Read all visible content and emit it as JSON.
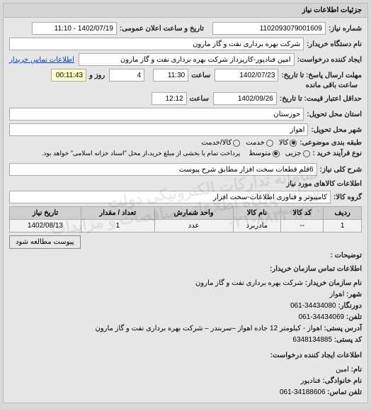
{
  "panel_title": "جزئیات اطلاعات نیاز",
  "labels": {
    "request_no": "شماره نیاز:",
    "announce_date": "تاریخ و ساعت اعلان عمومی:",
    "buyer_org": "نام دستگاه خریدار:",
    "creator": "ایجاد کننده درخواست:",
    "contact_link": "اطلاعات تماس خریدار",
    "deadline": "مهلت ارسال پاسخ: تا تاریخ:",
    "time": "ساعت",
    "day": "روز و",
    "remaining": "ساعت باقی مانده",
    "price_validity": "حداقل اعتبار قیمت: تا تاریخ:",
    "province": "استان محل تحویل:",
    "city": "شهر محل تحویل:",
    "category": "طبقه بندی موضوعی:",
    "process_type": "نوع فرآیند خرید :",
    "opt_goods": "کالا",
    "opt_service": "خدمت",
    "opt_goods_service": "کالا/خدمت",
    "opt_small": "جزیی",
    "opt_medium": "متوسط",
    "process_note": "پرداخت تمام یا بخشی از مبلغ خرید،از محل \"اسناد خزانه اسلامی\" خواهد بود.",
    "general_desc": "شرح کلی نیاز:",
    "goods_info_title": "اطلاعات کالاهای مورد نیاز",
    "goods_group": "گروه کالا:",
    "attach_btn": "پیوست مطالعه شود",
    "explanations": "توضیحات :",
    "contact_title": "اطلاعات تماس سازمان خریدار:",
    "org_name": "نام سازمان خریدار:",
    "city_info": "شهر:",
    "fax": "دورنگار:",
    "phone": "تلفن:",
    "address": "آدرس پستی:",
    "postal_code": "کد پستی:",
    "creator_title": "اطلاعات ایجاد کننده درخواست:",
    "name": "نام:",
    "surname": "نام خانوادگی:",
    "contact_phone": "تلفن تماس:"
  },
  "values": {
    "request_no": "1102093079001609",
    "announce_date": "1402/07/19 - 11:10",
    "buyer_org": "شرکت بهره برداری نفت و گاز مارون",
    "creator": "امین فنادپور-کارپرداز شرکت بهره برداری نفت و گاز مارون",
    "deadline_date": "1402/07/23",
    "deadline_time": "11:30",
    "remaining_days": "4",
    "remaining_time": "00:11:43",
    "validity_date": "1402/09/26",
    "validity_time": "12:12",
    "province": "خوزستان",
    "city": "اهواز",
    "general_desc": "6قلم قطعات سخت افزار مطابق شرح پیوست",
    "goods_group": "کامپیوتر و فناوری اطلاعات-سخت افزار",
    "org_name_val": "شرکت بهره برداری نفت و گاز مارون",
    "city_val": "اهواز",
    "fax_val": "34434080-061",
    "phone_val": "34434069-061",
    "address_val": "اهواز - کیلومتر 12 جاده اهواز –سربندر – شرکت بهره برداری نفت و گاز مارون",
    "postal_code_val": "6348134885",
    "name_val": "امین",
    "surname_val": "فنادپور",
    "contact_phone_val": "34188606-061"
  },
  "table": {
    "headers": [
      "ردیف",
      "کد کالا",
      "نام کالا",
      "واحد شمارش",
      "تعداد / مقدار",
      "تاریخ نیاز"
    ],
    "row": [
      "1",
      "--",
      "مادربرد",
      "عدد",
      "1",
      "1402/08/13"
    ]
  },
  "watermark": {
    "line1": "سامانه تدارکات الکترونیکی دولت",
    "line2": "ستاد - پایگاه اطلاعاتی مناقصات و مزایدات",
    "line3": "۰۲۱-۸۸۳۴۹۶۷۰"
  }
}
